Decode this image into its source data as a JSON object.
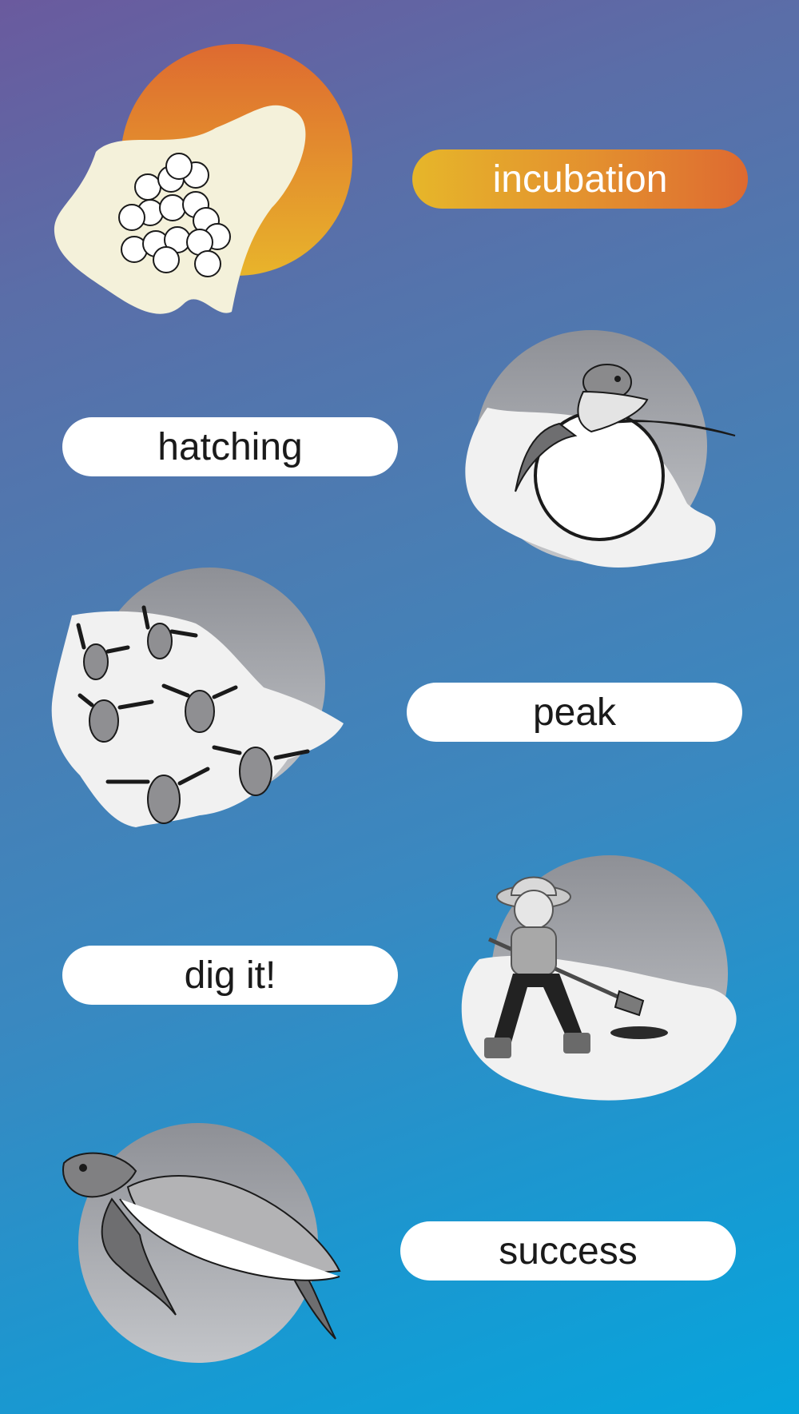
{
  "stages": [
    {
      "label": "incubation",
      "icon": "egg-clutch-icon",
      "active": true
    },
    {
      "label": "hatching",
      "icon": "hatchling-egg-icon",
      "active": false
    },
    {
      "label": "peak",
      "icon": "hatchlings-icon",
      "active": false
    },
    {
      "label": "dig it!",
      "icon": "digging-kid-icon",
      "active": false
    },
    {
      "label": "success",
      "icon": "sea-turtle-icon",
      "active": false
    }
  ],
  "colors": {
    "accent_start": "#e6b62a",
    "accent_end": "#de6a30",
    "pill_bg": "#ffffff",
    "sand": "#f4f1da",
    "gray_circle": "#9c9ea4"
  }
}
